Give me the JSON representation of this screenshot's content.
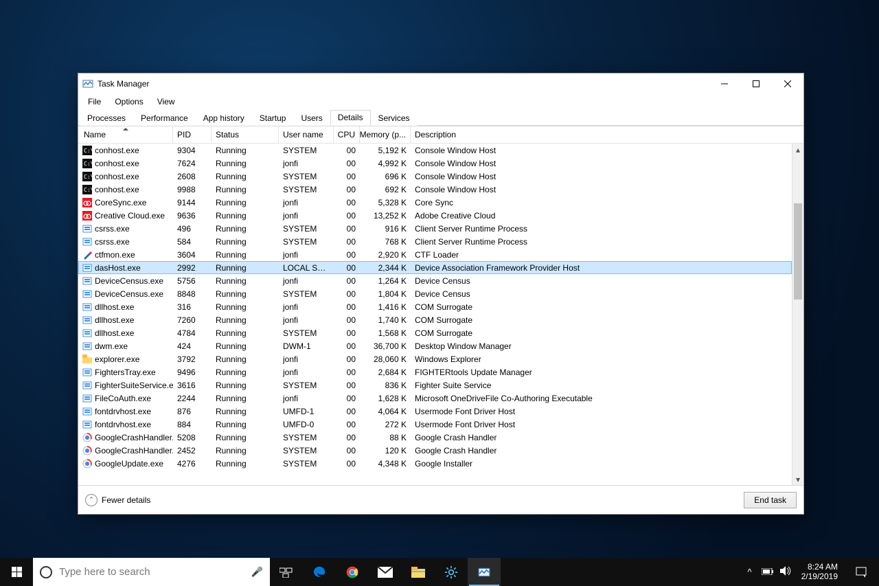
{
  "window": {
    "title": "Task Manager",
    "menu": [
      "File",
      "Options",
      "View"
    ],
    "tabs": [
      "Processes",
      "Performance",
      "App history",
      "Startup",
      "Users",
      "Details",
      "Services"
    ],
    "activeTab": 5,
    "columns": [
      "Name",
      "PID",
      "Status",
      "User name",
      "CPU",
      "Memory (p...",
      "Description"
    ],
    "sortColumn": 0,
    "footer": {
      "fewer": "Fewer details",
      "endTask": "End task"
    },
    "selectedIndex": 9
  },
  "processes": [
    {
      "icon": "cmd",
      "name": "conhost.exe",
      "pid": "9304",
      "status": "Running",
      "user": "SYSTEM",
      "cpu": "00",
      "mem": "5,192 K",
      "desc": "Console Window Host"
    },
    {
      "icon": "cmd",
      "name": "conhost.exe",
      "pid": "7624",
      "status": "Running",
      "user": "jonfi",
      "cpu": "00",
      "mem": "4,992 K",
      "desc": "Console Window Host"
    },
    {
      "icon": "cmd",
      "name": "conhost.exe",
      "pid": "2608",
      "status": "Running",
      "user": "SYSTEM",
      "cpu": "00",
      "mem": "696 K",
      "desc": "Console Window Host"
    },
    {
      "icon": "cmd",
      "name": "conhost.exe",
      "pid": "9988",
      "status": "Running",
      "user": "SYSTEM",
      "cpu": "00",
      "mem": "692 K",
      "desc": "Console Window Host"
    },
    {
      "icon": "cc",
      "name": "CoreSync.exe",
      "pid": "9144",
      "status": "Running",
      "user": "jonfi",
      "cpu": "00",
      "mem": "5,328 K",
      "desc": "Core Sync"
    },
    {
      "icon": "cc",
      "name": "Creative Cloud.exe",
      "pid": "9636",
      "status": "Running",
      "user": "jonfi",
      "cpu": "00",
      "mem": "13,252 K",
      "desc": "Adobe Creative Cloud"
    },
    {
      "icon": "sys",
      "name": "csrss.exe",
      "pid": "496",
      "status": "Running",
      "user": "SYSTEM",
      "cpu": "00",
      "mem": "916 K",
      "desc": "Client Server Runtime Process"
    },
    {
      "icon": "sys",
      "name": "csrss.exe",
      "pid": "584",
      "status": "Running",
      "user": "SYSTEM",
      "cpu": "00",
      "mem": "768 K",
      "desc": "Client Server Runtime Process"
    },
    {
      "icon": "pen",
      "name": "ctfmon.exe",
      "pid": "3604",
      "status": "Running",
      "user": "jonfi",
      "cpu": "00",
      "mem": "2,920 K",
      "desc": "CTF Loader"
    },
    {
      "icon": "sys",
      "name": "dasHost.exe",
      "pid": "2992",
      "status": "Running",
      "user": "LOCAL SE...",
      "cpu": "00",
      "mem": "2,344 K",
      "desc": "Device Association Framework Provider Host"
    },
    {
      "icon": "sys",
      "name": "DeviceCensus.exe",
      "pid": "5756",
      "status": "Running",
      "user": "jonfi",
      "cpu": "00",
      "mem": "1,264 K",
      "desc": "Device Census"
    },
    {
      "icon": "sys",
      "name": "DeviceCensus.exe",
      "pid": "8848",
      "status": "Running",
      "user": "SYSTEM",
      "cpu": "00",
      "mem": "1,804 K",
      "desc": "Device Census"
    },
    {
      "icon": "sys",
      "name": "dllhost.exe",
      "pid": "316",
      "status": "Running",
      "user": "jonfi",
      "cpu": "00",
      "mem": "1,416 K",
      "desc": "COM Surrogate"
    },
    {
      "icon": "sys",
      "name": "dllhost.exe",
      "pid": "7260",
      "status": "Running",
      "user": "jonfi",
      "cpu": "00",
      "mem": "1,740 K",
      "desc": "COM Surrogate"
    },
    {
      "icon": "sys",
      "name": "dllhost.exe",
      "pid": "4784",
      "status": "Running",
      "user": "SYSTEM",
      "cpu": "00",
      "mem": "1,568 K",
      "desc": "COM Surrogate"
    },
    {
      "icon": "sys",
      "name": "dwm.exe",
      "pid": "424",
      "status": "Running",
      "user": "DWM-1",
      "cpu": "00",
      "mem": "36,700 K",
      "desc": "Desktop Window Manager"
    },
    {
      "icon": "folder",
      "name": "explorer.exe",
      "pid": "3792",
      "status": "Running",
      "user": "jonfi",
      "cpu": "00",
      "mem": "28,060 K",
      "desc": "Windows Explorer"
    },
    {
      "icon": "sys",
      "name": "FightersTray.exe",
      "pid": "9496",
      "status": "Running",
      "user": "jonfi",
      "cpu": "00",
      "mem": "2,684 K",
      "desc": "FIGHTERtools Update Manager"
    },
    {
      "icon": "sys",
      "name": "FighterSuiteService.e...",
      "pid": "3616",
      "status": "Running",
      "user": "SYSTEM",
      "cpu": "00",
      "mem": "836 K",
      "desc": "Fighter Suite Service"
    },
    {
      "icon": "sys",
      "name": "FileCoAuth.exe",
      "pid": "2244",
      "status": "Running",
      "user": "jonfi",
      "cpu": "00",
      "mem": "1,628 K",
      "desc": "Microsoft OneDriveFile Co-Authoring Executable"
    },
    {
      "icon": "sys",
      "name": "fontdrvhost.exe",
      "pid": "876",
      "status": "Running",
      "user": "UMFD-1",
      "cpu": "00",
      "mem": "4,064 K",
      "desc": "Usermode Font Driver Host"
    },
    {
      "icon": "sys",
      "name": "fontdrvhost.exe",
      "pid": "884",
      "status": "Running",
      "user": "UMFD-0",
      "cpu": "00",
      "mem": "272 K",
      "desc": "Usermode Font Driver Host"
    },
    {
      "icon": "g",
      "name": "GoogleCrashHandler...",
      "pid": "5208",
      "status": "Running",
      "user": "SYSTEM",
      "cpu": "00",
      "mem": "88 K",
      "desc": "Google Crash Handler"
    },
    {
      "icon": "g",
      "name": "GoogleCrashHandler...",
      "pid": "2452",
      "status": "Running",
      "user": "SYSTEM",
      "cpu": "00",
      "mem": "120 K",
      "desc": "Google Crash Handler"
    },
    {
      "icon": "g",
      "name": "GoogleUpdate.exe",
      "pid": "4276",
      "status": "Running",
      "user": "SYSTEM",
      "cpu": "00",
      "mem": "4,348 K",
      "desc": "Google Installer"
    }
  ],
  "taskbar": {
    "searchPlaceholder": "Type here to search",
    "clock": {
      "time": "8:24 AM",
      "date": "2/19/2019"
    }
  }
}
